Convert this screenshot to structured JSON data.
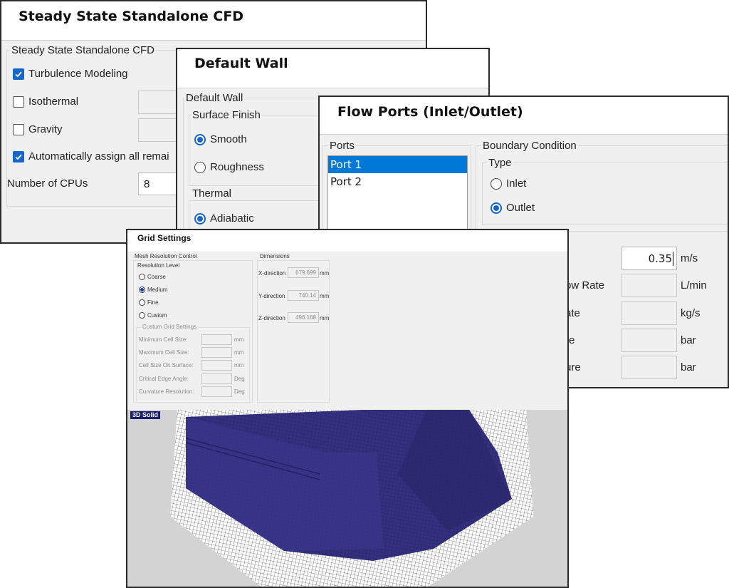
{
  "window1": {
    "title": "Steady State Standalone CFD",
    "group_label": "Steady State Standalone CFD",
    "options": [
      {
        "label": "Turbulence Modeling",
        "checked": true
      },
      {
        "label": "Isothermal",
        "checked": false
      },
      {
        "label": "Gravity",
        "checked": false
      },
      {
        "label": "Automatically assign all remai",
        "checked": true
      }
    ],
    "cpu_label": "Number of CPUs",
    "cpu_value": "8"
  },
  "window2": {
    "title": "Default Wall",
    "group_label": "Default Wall",
    "surface_finish": {
      "label": "Surface Finish",
      "options": [
        {
          "label": "Smooth",
          "selected": true
        },
        {
          "label": "Roughness",
          "selected": false
        }
      ]
    },
    "thermal": {
      "label": "Thermal",
      "options": [
        {
          "label": "Adiabatic",
          "selected": true
        }
      ]
    }
  },
  "window3": {
    "title": "Flow Ports (Inlet/Outlet)",
    "ports_label": "Ports",
    "ports": [
      {
        "label": "Port 1",
        "selected": true
      },
      {
        "label": "Port 2",
        "selected": false
      }
    ],
    "boundary_label": "Boundary Condition",
    "type_label": "Type",
    "type_options": [
      {
        "label": "Inlet",
        "selected": false
      },
      {
        "label": "Outlet",
        "selected": true
      }
    ],
    "fields": [
      {
        "label": "",
        "value": "0.35",
        "unit": "m/s"
      },
      {
        "label": "ow Rate",
        "value": "",
        "unit": "L/min"
      },
      {
        "label": "ate",
        "value": "",
        "unit": "kg/s"
      },
      {
        "label": "re",
        "value": "",
        "unit": "bar"
      },
      {
        "label": "ure",
        "value": "",
        "unit": "bar"
      }
    ]
  },
  "window4": {
    "title": "Grid Settings",
    "mesh_group_label": "Mesh Resolution Control",
    "resolution_label": "Resolution Level",
    "resolution_options": [
      {
        "label": "Coarse",
        "selected": false
      },
      {
        "label": "Medium",
        "selected": true
      },
      {
        "label": "Fine",
        "selected": false
      },
      {
        "label": "Custom",
        "selected": false
      }
    ],
    "custom_group_label": "Custum Grid Settings",
    "custom_fields": [
      {
        "label": "Minimum Cell Size:",
        "unit": "mm"
      },
      {
        "label": "Maximum Cell Size:",
        "unit": "mm"
      },
      {
        "label": "Cell Size On Surface:",
        "unit": "mm"
      },
      {
        "label": "Critical Edge Angle:",
        "unit": "Deg"
      },
      {
        "label": "Curvature Resolution:",
        "unit": "Deg"
      }
    ],
    "dimensions_label": "Dimensions",
    "dimensions": [
      {
        "label": "X-direction",
        "value": "679.699",
        "unit": "mm"
      },
      {
        "label": "Y-direction",
        "value": "740.14",
        "unit": "mm"
      },
      {
        "label": "Z-direction",
        "value": "496.168",
        "unit": "mm"
      }
    ],
    "viewport_tag": "3D Solid"
  },
  "colors": {
    "accent": "#1466c8",
    "list_selection": "#0078d7",
    "mesh_solid": "#34307e",
    "viewport_bg": "#d3d3d3",
    "viewport_tag_bg": "#1a1a6e"
  }
}
